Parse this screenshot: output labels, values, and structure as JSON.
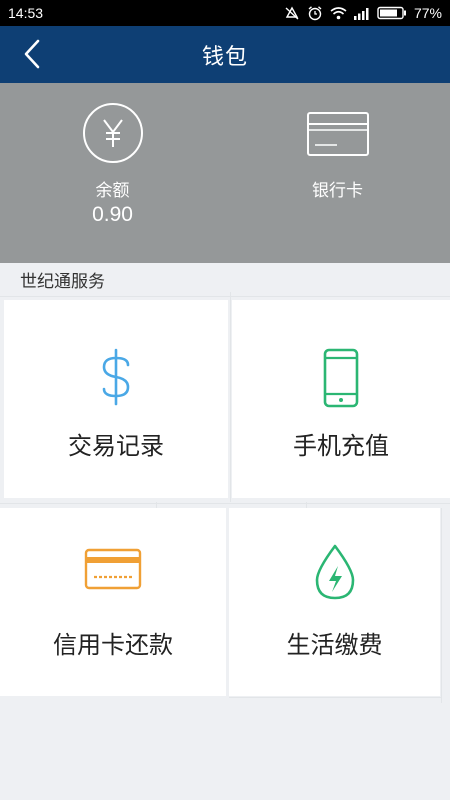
{
  "status_bar": {
    "time": "14:53",
    "battery": "77%",
    "icons": [
      "mute-icon",
      "alarm-icon",
      "wifi-icon",
      "signal-icon",
      "battery-icon"
    ]
  },
  "nav": {
    "title": "钱包",
    "back_icon": "chevron-left-icon"
  },
  "wallet": {
    "balance_label": "余额",
    "balance_amount": "0.90",
    "balance_icon": "yen-circle-icon",
    "bank_label": "银行卡",
    "bank_icon": "bank-card-icon"
  },
  "services": {
    "title": "世纪通服务",
    "items": [
      {
        "label": "交易记录",
        "icon": "dollar-icon",
        "color": "#4aa8e6"
      },
      {
        "label": "手机充值",
        "icon": "mobile-phone-icon",
        "color": "#2bb673"
      },
      {
        "label": "信用卡还款",
        "icon": "credit-card-icon",
        "color": "#f0a035"
      },
      {
        "label": "生活缴费",
        "icon": "water-drop-bolt-icon",
        "color": "#2bb673"
      }
    ]
  },
  "colors": {
    "nav_bg": "#0e3f74",
    "wallet_bg": "#959899",
    "page_bg": "#eef0f3"
  }
}
